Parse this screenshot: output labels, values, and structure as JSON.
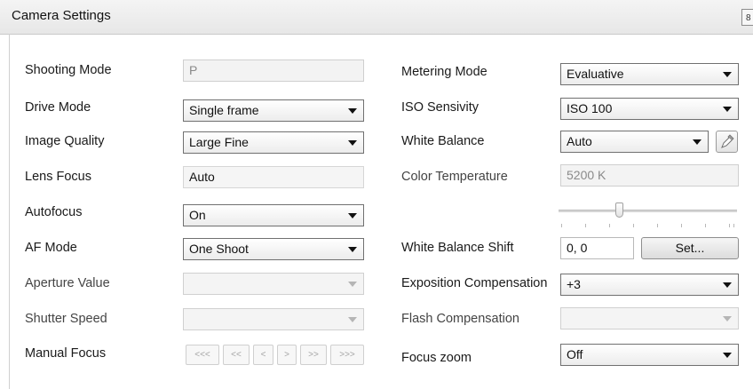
{
  "window": {
    "title": "Camera Settings",
    "close_glyph": "8"
  },
  "left": {
    "shooting_mode": {
      "label": "Shooting Mode",
      "value": "P"
    },
    "drive_mode": {
      "label": "Drive Mode",
      "value": "Single frame"
    },
    "image_quality": {
      "label": "Image Quality",
      "value": "Large Fine"
    },
    "lens_focus": {
      "label": "Lens Focus",
      "value": "Auto"
    },
    "autofocus": {
      "label": "Autofocus",
      "value": "On"
    },
    "af_mode": {
      "label": "AF Mode",
      "value": "One Shoot"
    },
    "aperture_value": {
      "label": "Aperture Value",
      "value": ""
    },
    "shutter_speed": {
      "label": "Shutter Speed",
      "value": ""
    },
    "manual_focus": {
      "label": "Manual Focus",
      "buttons": [
        "<<<",
        "<<",
        "<",
        ">",
        ">>",
        ">>>"
      ]
    }
  },
  "right": {
    "metering_mode": {
      "label": "Metering Mode",
      "value": "Evaluative"
    },
    "iso": {
      "label": "ISO Sensivity",
      "value": "ISO 100"
    },
    "white_balance": {
      "label": "White Balance",
      "value": "Auto",
      "picker_icon": "eyedropper-icon"
    },
    "color_temperature": {
      "label": "Color Temperature",
      "value": "5200 K",
      "slider_position": 0.32
    },
    "white_balance_shift": {
      "label": "White Balance Shift",
      "value": "0, 0",
      "button": "Set..."
    },
    "exposition_compensation": {
      "label": "Exposition Compensation",
      "value": "+3"
    },
    "flash_compensation": {
      "label": "Flash Compensation",
      "value": ""
    },
    "focus_zoom": {
      "label": "Focus zoom",
      "value": "Off"
    }
  }
}
